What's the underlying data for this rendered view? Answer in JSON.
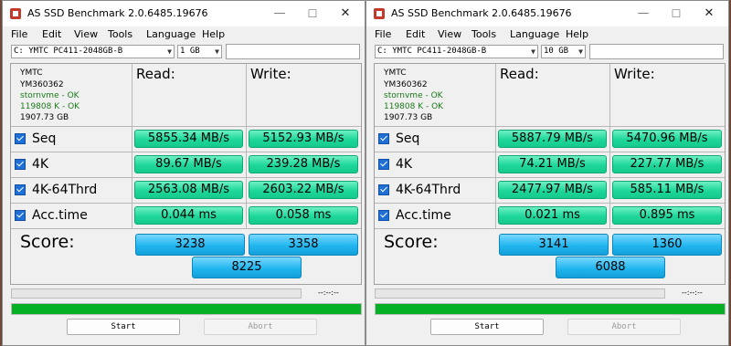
{
  "windows": [
    {
      "title": "AS SSD Benchmark 2.0.6485.19676",
      "window_controls": [
        "—",
        "☐",
        "✕"
      ],
      "menu": [
        "File",
        "Edit",
        "View",
        "Tools",
        "Language",
        "Help"
      ],
      "drive_select": "C: YMTC PC411-2048GB-B",
      "size_select": "1 GB",
      "info": {
        "vendor": "YMTC",
        "model": "YM360362",
        "driver": "stornvme - OK",
        "alignment": "119808 K - OK",
        "capacity": "1907.73 GB"
      },
      "headers": {
        "read": "Read:",
        "write": "Write:"
      },
      "rows": [
        {
          "label": "Seq",
          "read": "5855.34 MB/s",
          "write": "5152.93 MB/s"
        },
        {
          "label": "4K",
          "read": "89.67 MB/s",
          "write": "239.28 MB/s"
        },
        {
          "label": "4K-64Thrd",
          "read": "2563.08 MB/s",
          "write": "2603.22 MB/s"
        },
        {
          "label": "Acc.time",
          "read": "0.044 ms",
          "write": "0.058 ms"
        }
      ],
      "score": {
        "label": "Score:",
        "read": "3238",
        "write": "3358",
        "total": "8225"
      },
      "time": "--:--:--",
      "progress": 1.0,
      "buttons": {
        "start": "Start",
        "abort": "Abort"
      }
    },
    {
      "title": "AS SSD Benchmark 2.0.6485.19676",
      "window_controls": [
        "—",
        "☐",
        "✕"
      ],
      "menu": [
        "File",
        "Edit",
        "View",
        "Tools",
        "Language",
        "Help"
      ],
      "drive_select": "C: YMTC PC411-2048GB-B",
      "size_select": "10 GB",
      "info": {
        "vendor": "YMTC",
        "model": "YM360362",
        "driver": "stornvme - OK",
        "alignment": "119808 K - OK",
        "capacity": "1907.73 GB"
      },
      "headers": {
        "read": "Read:",
        "write": "Write:"
      },
      "rows": [
        {
          "label": "Seq",
          "read": "5887.79 MB/s",
          "write": "5470.96 MB/s"
        },
        {
          "label": "4K",
          "read": "74.21 MB/s",
          "write": "227.77 MB/s"
        },
        {
          "label": "4K-64Thrd",
          "read": "2477.97 MB/s",
          "write": "585.11 MB/s"
        },
        {
          "label": "Acc.time",
          "read": "0.021 ms",
          "write": "0.895 ms"
        }
      ],
      "score": {
        "label": "Score:",
        "read": "3141",
        "write": "1360",
        "total": "6088"
      },
      "time": "--:--:--",
      "progress": 1.0,
      "buttons": {
        "start": "Start",
        "abort": "Abort"
      }
    }
  ],
  "colors": {
    "result_green": "#1fd79b",
    "score_blue": "#21b6ef",
    "progress_green": "#06b025",
    "ok_text": "#1a7a1a",
    "desktop": "#6b4a3a"
  }
}
